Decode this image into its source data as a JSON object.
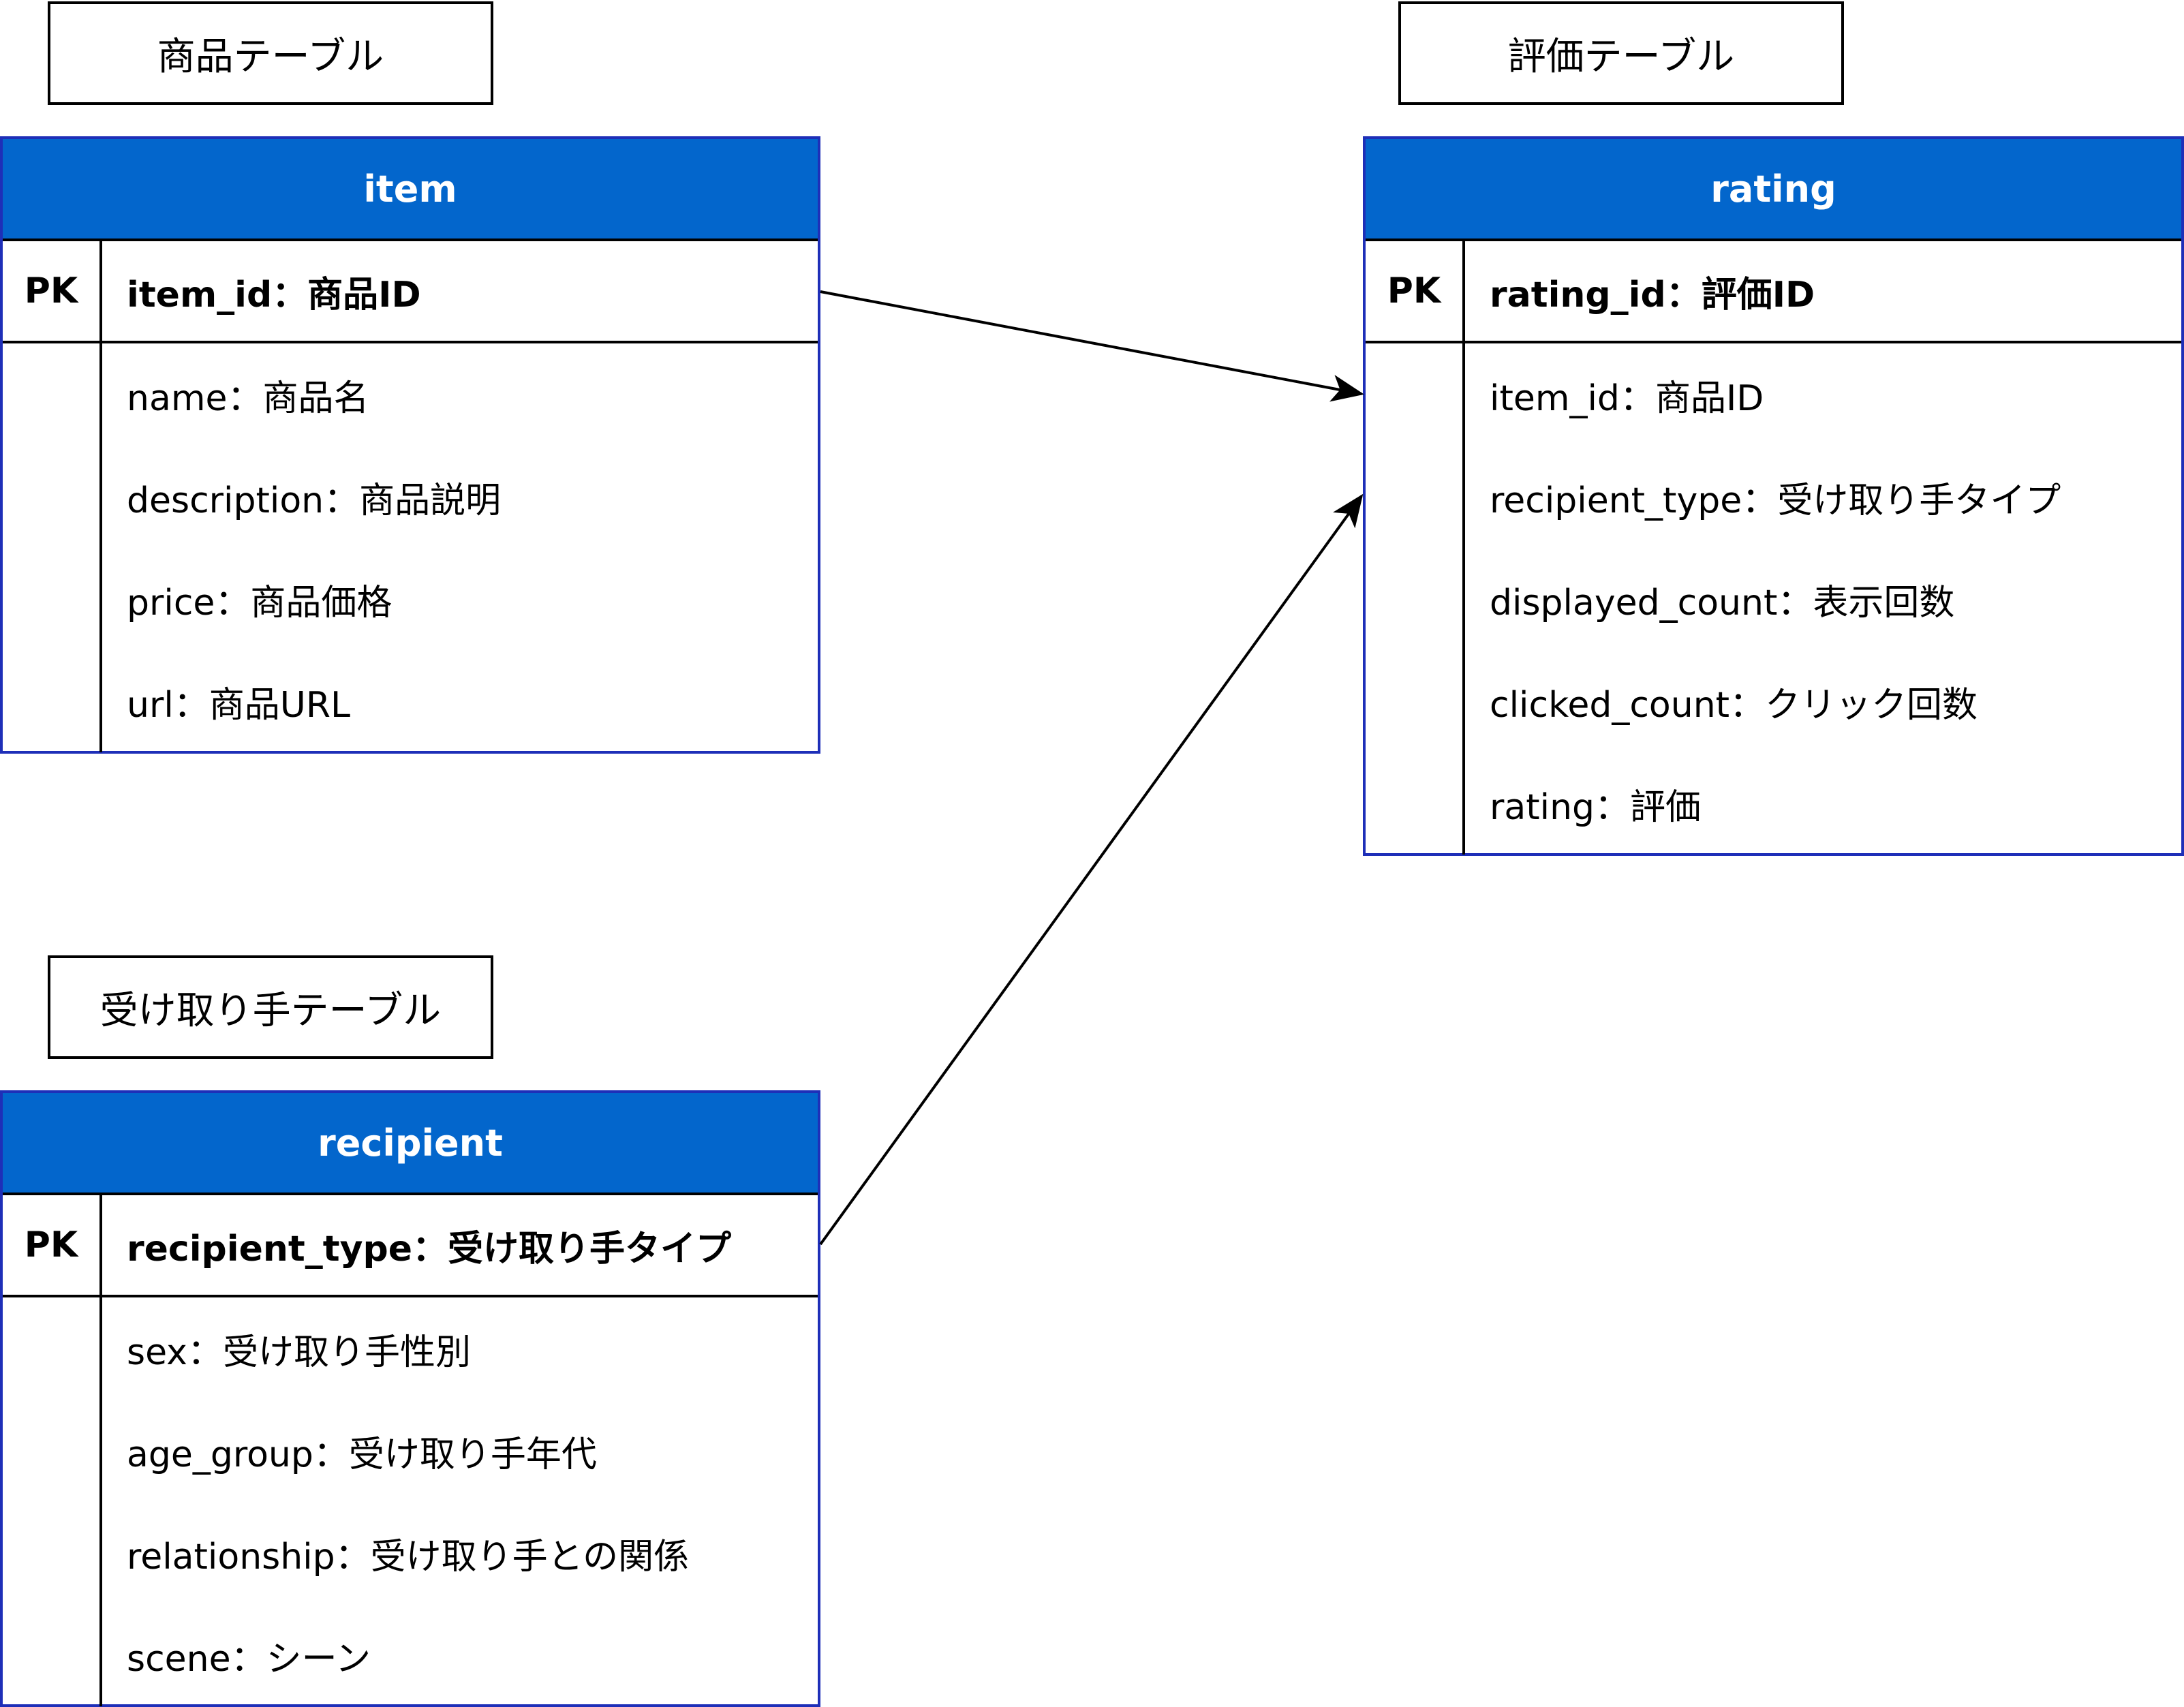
{
  "captions": {
    "item_caption": "商品テーブル",
    "rating_caption": "評価テーブル",
    "recipient_caption": "受け取り手テーブル"
  },
  "tables": {
    "item": {
      "name": "item",
      "pk_label": "PK",
      "pk_field": "item_id：商品ID",
      "fields": [
        "name：商品名",
        "description：商品説明",
        "price：商品価格",
        "url：商品URL"
      ]
    },
    "rating": {
      "name": "rating",
      "pk_label": "PK",
      "pk_field": "rating_id：評価ID",
      "fields": [
        "item_id：商品ID",
        "recipient_type：受け取り手タイプ",
        "displayed_count：表示回数",
        "clicked_count：クリック回数",
        "rating：評価"
      ]
    },
    "recipient": {
      "name": "recipient",
      "pk_label": "PK",
      "pk_field": "recipient_type：受け取り手タイプ",
      "fields": [
        "sex：受け取り手性別",
        "age_group：受け取り手年代",
        "relationship：受け取り手との関係",
        "scene：シーン"
      ]
    }
  },
  "colors": {
    "header_fill": "#0366cc",
    "table_border": "#1e2fb8",
    "line": "#000000"
  }
}
